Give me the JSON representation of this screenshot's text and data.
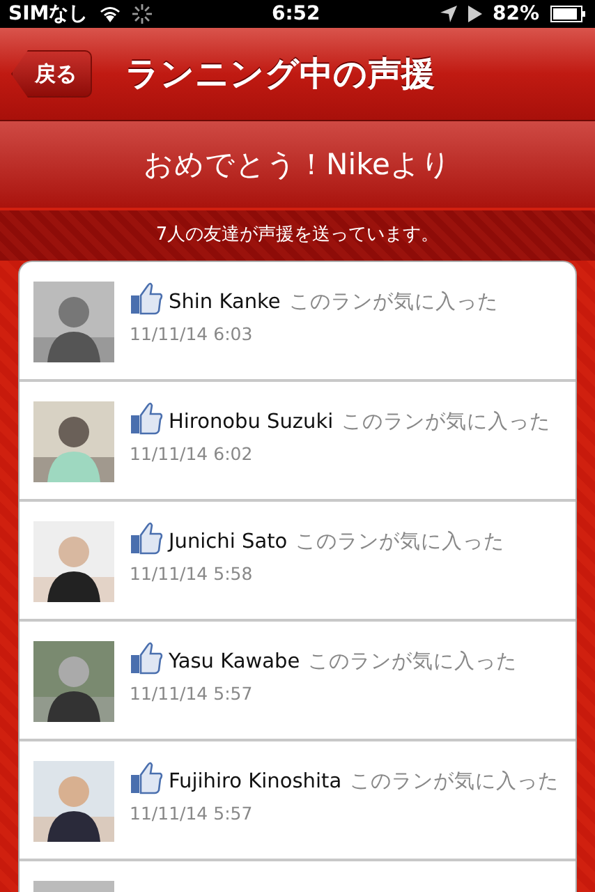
{
  "status_bar": {
    "carrier": "SIMなし",
    "time": "6:52",
    "battery": "82%"
  },
  "nav": {
    "back": "戻る",
    "title": "ランニング中の声援"
  },
  "header": {
    "title": "おめでとう！Nikeより",
    "subtitle": "7人の友達が声援を送っています。"
  },
  "cheers": [
    {
      "name": "Shin Kanke",
      "comment": "このランが気に入った",
      "date": "11/11/14 6:03"
    },
    {
      "name": "Hironobu Suzuki",
      "comment": "このランが気に入った",
      "date": "11/11/14 6:02"
    },
    {
      "name": "Junichi Sato",
      "comment": "このランが気に入った",
      "date": "11/11/14 5:58"
    },
    {
      "name": "Yasu Kawabe",
      "comment": "このランが気に入った",
      "date": "11/11/14 5:57"
    },
    {
      "name": "Fujihiro Kinoshita",
      "comment": "このランが気に入った",
      "date": "11/11/14 5:57"
    }
  ]
}
